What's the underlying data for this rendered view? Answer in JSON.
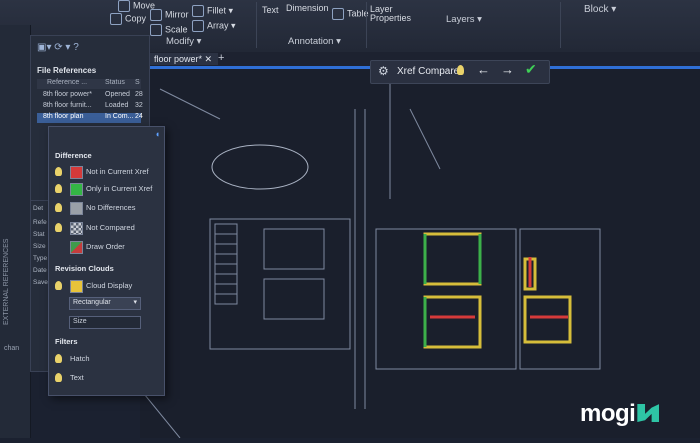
{
  "ribbon": {
    "move": "Move",
    "copy": "Copy",
    "mirror": "Mirror",
    "fillet": "Fillet",
    "scale": "Scale",
    "array": "Array",
    "text": "Text",
    "dimension": "Dimension",
    "table": "Table",
    "layer_properties": "Layer Properties",
    "block": "Block",
    "groups": {
      "modify": "Modify",
      "annotation": "Annotation",
      "layers": "Layers"
    }
  },
  "tab": {
    "label": "floor power*"
  },
  "xref_toolbar": {
    "label": "Xref Compare"
  },
  "file_references": {
    "title": "File References",
    "columns": [
      "Reference ...",
      "Status",
      "S"
    ],
    "rows": [
      {
        "name": "8th floor power*",
        "status": "Opened",
        "size": "28"
      },
      {
        "name": "8th floor furnit...",
        "status": "Loaded",
        "size": "32"
      },
      {
        "name": "8th floor plan",
        "status": "In Com...",
        "size": "24"
      }
    ]
  },
  "details": [
    "Det",
    "Refe",
    "Stat",
    "Size",
    "Type",
    "Date",
    "Save"
  ],
  "side_panel_label": "EXTERNAL REFERENCES",
  "side_text": "chan",
  "compare_popup": {
    "difference_title": "Difference",
    "options": [
      {
        "label": "Not in Current Xref",
        "color": "#d43a3a"
      },
      {
        "label": "Only in Current Xref",
        "color": "#34b545"
      },
      {
        "label": "No Differences",
        "color": "#9aa0a8"
      },
      {
        "label": "Not Compared",
        "color": "#c9cdd4"
      },
      {
        "label": "Draw Order",
        "color": "#3f9a4b"
      }
    ],
    "revision_title": "Revision Clouds",
    "cloud_display": "Cloud Display",
    "cloud_color": "#e8c33a",
    "shape": "Rectangular",
    "size": "Size",
    "filters_title": "Filters",
    "filters": [
      "Hatch",
      "Text"
    ]
  },
  "logo": {
    "text": "mogi"
  }
}
